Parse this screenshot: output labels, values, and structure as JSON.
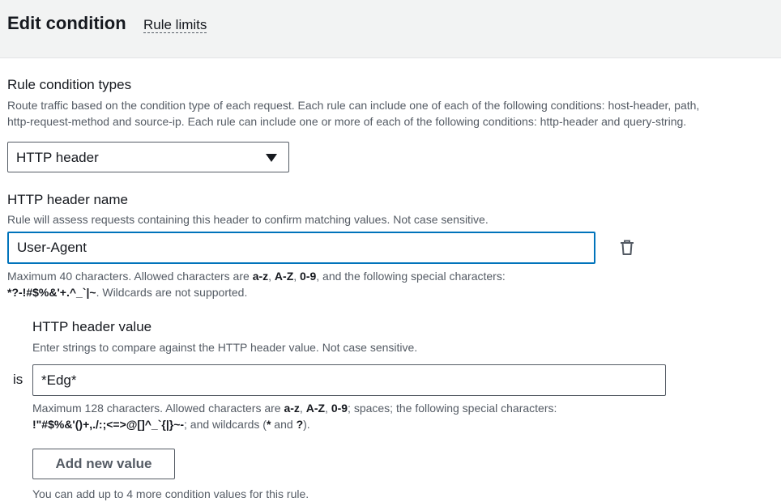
{
  "header": {
    "title": "Edit condition",
    "rule_limits_link": "Rule limits"
  },
  "condition_types": {
    "label": "Rule condition types",
    "description_line1": "Route traffic based on the condition type of each request. Each rule can include one of each of the following conditions: host-header, path,",
    "description_line2": "http-request-method and source-ip. Each rule can include one or more of each of the following conditions: http-header and query-string.",
    "selected": "HTTP header"
  },
  "header_name": {
    "label": "HTTP header name",
    "description": "Rule will assess requests containing this header to confirm matching values. Not case sensitive.",
    "value": "User-Agent",
    "constraint_line1_pre": "Maximum 40 characters. Allowed characters are ",
    "constraint_az": "a-z",
    "constraint_sep1": ", ",
    "constraint_AZ": "A-Z",
    "constraint_sep2": ", ",
    "constraint_09": "0-9",
    "constraint_line1_post": ", and the following special characters:",
    "constraint_special": "*?-!#$%&'+.^_`|~",
    "constraint_line2_post": ". Wildcards are not supported."
  },
  "header_value": {
    "label": "HTTP header value",
    "description": "Enter strings to compare against the HTTP header value. Not case sensitive.",
    "operator": "is",
    "value": "*Edg*",
    "constraint_line1_pre": "Maximum 128 characters. Allowed characters are ",
    "constraint_az": "a-z",
    "constraint_sep1": ", ",
    "constraint_AZ": "A-Z",
    "constraint_sep2": ", ",
    "constraint_09": "0-9",
    "constraint_line1_post": "; spaces; the following special characters:",
    "constraint_special": "!\"#$%&'()+,./:;<=>@[]^_`{|}~-",
    "constraint_line2_mid": "; and wildcards (",
    "constraint_wild1": "*",
    "constraint_and": " and ",
    "constraint_wild2": "?",
    "constraint_end": ").",
    "add_button": "Add new value",
    "footer_note": "You can add up to 4 more condition values for this rule."
  },
  "colors": {
    "focus_border": "#0073bb",
    "header_bg": "#f2f3f3",
    "secondary_text": "#545b64"
  }
}
